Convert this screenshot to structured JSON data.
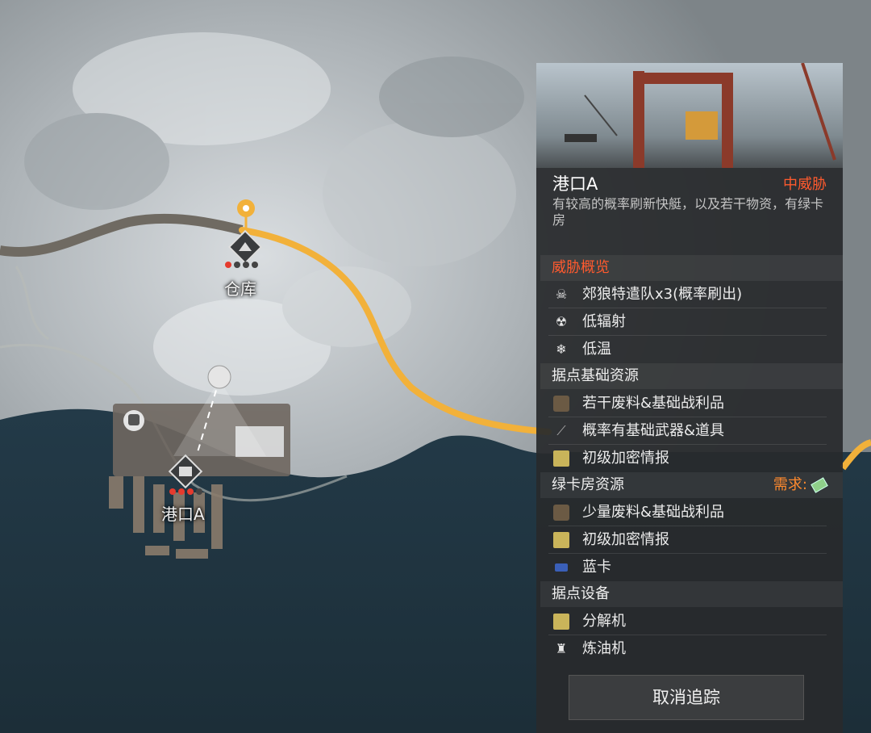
{
  "map": {
    "markers": [
      {
        "id": "warehouse",
        "label": "仓库"
      },
      {
        "id": "port-a",
        "label": "港口A"
      }
    ],
    "route_color": "#f2b13a"
  },
  "panel": {
    "location_name": "港口A",
    "threat_level": "中威胁",
    "description": "有较高的概率刷新快艇，以及若干物资，有绿卡房",
    "sections": {
      "threat": {
        "title": "威胁概览",
        "items": [
          {
            "icon": "skull-icon",
            "text": "郊狼特遣队x3(概率刷出)"
          },
          {
            "icon": "radiation-mask-icon",
            "text": "低辐射"
          },
          {
            "icon": "snowflake-icon",
            "text": "低温"
          }
        ]
      },
      "base_resources": {
        "title": "据点基础资源",
        "items": [
          {
            "icon": "scrap-box-icon",
            "text": "若干废料&基础战利品"
          },
          {
            "icon": "weapon-icon",
            "text": "概率有基础武器&道具"
          },
          {
            "icon": "intel-doc-icon",
            "text": "初级加密情报"
          }
        ]
      },
      "green_room": {
        "title": "绿卡房资源",
        "requirement_label": "需求:",
        "items": [
          {
            "icon": "scrap-box-icon",
            "text": "少量废料&基础战利品"
          },
          {
            "icon": "intel-doc-icon",
            "text": "初级加密情报"
          },
          {
            "icon": "blue-card-icon",
            "text": "蓝卡"
          }
        ]
      },
      "facilities": {
        "title": "据点设备",
        "items": [
          {
            "icon": "disassembler-icon",
            "text": "分解机"
          },
          {
            "icon": "refinery-icon",
            "text": "炼油机"
          }
        ]
      }
    },
    "cancel_label": "取消追踪",
    "colors": {
      "threat": "#ff5a2e",
      "requirement": "#ff8a2e"
    }
  }
}
